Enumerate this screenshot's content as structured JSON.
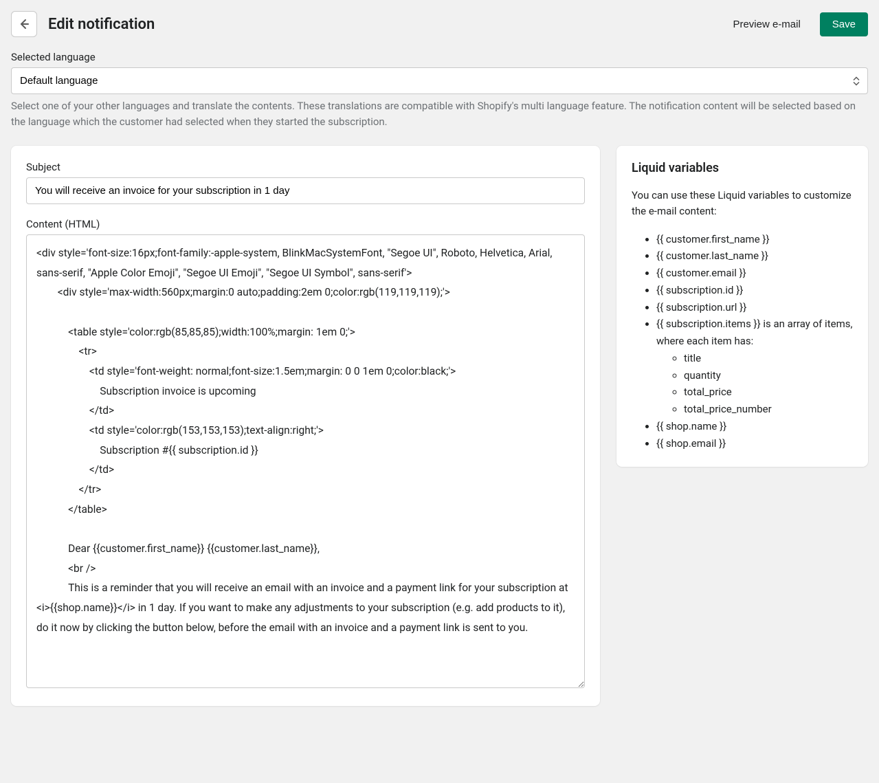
{
  "header": {
    "title": "Edit notification",
    "preview_label": "Preview e-mail",
    "save_label": "Save"
  },
  "language": {
    "label": "Selected language",
    "selected": "Default language",
    "help": "Select one of your other languages and translate the contents. These translations are compatible with Shopify's multi language feature. The notification content will be selected based on the language which the customer had selected when they started the subscription."
  },
  "form": {
    "subject_label": "Subject",
    "subject_value": "You will receive an invoice for your subscription in 1 day",
    "content_label": "Content (HTML)",
    "content_value": "<div style='font-size:16px;font-family:-apple-system, BlinkMacSystemFont, \"Segoe UI\", Roboto, Helvetica, Arial, sans-serif, \"Apple Color Emoji\", \"Segoe UI Emoji\", \"Segoe UI Symbol\", sans-serif'>\n        <div style='max-width:560px;margin:0 auto;padding:2em 0;color:rgb(119,119,119);'>\n\n            <table style='color:rgb(85,85,85);width:100%;margin: 1em 0;'>\n                <tr>\n                    <td style='font-weight: normal;font-size:1.5em;margin: 0 0 1em 0;color:black;'>\n                        Subscription invoice is upcoming\n                    </td>\n                    <td style='color:rgb(153,153,153);text-align:right;'>\n                        Subscription #{{ subscription.id }}\n                    </td>\n                </tr>\n            </table>\n\n            Dear {{customer.first_name}} {{customer.last_name}},\n            <br />\n            This is a reminder that you will receive an email with an invoice and a payment link for your subscription at <i>{{shop.name}}</i> in 1 day. If you want to make any adjustments to your subscription (e.g. add products to it), do it now by clicking the button below, before the email with an invoice and a payment link is sent to you."
  },
  "sidebar": {
    "title": "Liquid variables",
    "intro": "You can use these Liquid variables to customize the e-mail content:",
    "vars": [
      {
        "text": "{{ customer.first_name }}"
      },
      {
        "text": "{{ customer.last_name }}"
      },
      {
        "text": "{{ customer.email }}"
      },
      {
        "text": "{{ subscription.id }}"
      },
      {
        "text": "{{ subscription.url }}"
      },
      {
        "text": "{{ subscription.items }} is an array of items, where each item has:",
        "sub": [
          "title",
          "quantity",
          "total_price",
          "total_price_number"
        ]
      },
      {
        "text": "{{ shop.name }}"
      },
      {
        "text": "{{ shop.email }}"
      }
    ]
  }
}
